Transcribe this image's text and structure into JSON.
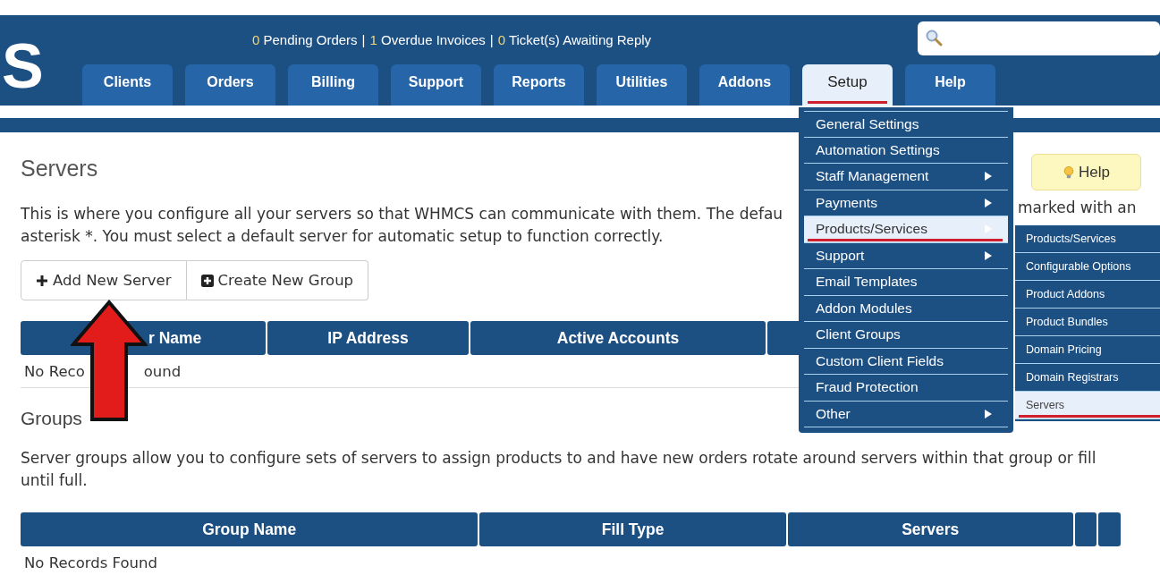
{
  "header": {
    "logo": "S",
    "separator": "|",
    "stats": [
      {
        "count": "0",
        "label": "Pending Orders"
      },
      {
        "count": "1",
        "label": "Overdue Invoices"
      },
      {
        "count": "0",
        "label": "Ticket(s) Awaiting Reply"
      }
    ]
  },
  "tabs": [
    {
      "label": "Clients",
      "selected": false
    },
    {
      "label": "Orders",
      "selected": false
    },
    {
      "label": "Billing",
      "selected": false
    },
    {
      "label": "Support",
      "selected": false
    },
    {
      "label": "Reports",
      "selected": false
    },
    {
      "label": "Utilities",
      "selected": false
    },
    {
      "label": "Addons",
      "selected": false
    },
    {
      "label": "Setup",
      "selected": true
    },
    {
      "label": "Help",
      "selected": false
    }
  ],
  "setup_menu": [
    {
      "label": "General Settings",
      "has_submenu": false,
      "selected": false
    },
    {
      "label": "Automation Settings",
      "has_submenu": false,
      "selected": false
    },
    {
      "label": "Staff Management",
      "has_submenu": true,
      "selected": false
    },
    {
      "label": "Payments",
      "has_submenu": true,
      "selected": false
    },
    {
      "label": "Products/Services",
      "has_submenu": true,
      "selected": true
    },
    {
      "label": "Support",
      "has_submenu": true,
      "selected": false
    },
    {
      "label": "Email Templates",
      "has_submenu": false,
      "selected": false
    },
    {
      "label": "Addon Modules",
      "has_submenu": false,
      "selected": false
    },
    {
      "label": "Client Groups",
      "has_submenu": false,
      "selected": false
    },
    {
      "label": "Custom Client Fields",
      "has_submenu": false,
      "selected": false
    },
    {
      "label": "Fraud Protection",
      "has_submenu": false,
      "selected": false
    },
    {
      "label": "Other",
      "has_submenu": true,
      "selected": false
    }
  ],
  "submenu": [
    {
      "label": "Products/Services",
      "selected": false
    },
    {
      "label": "Configurable Options",
      "selected": false
    },
    {
      "label": "Product Addons",
      "selected": false
    },
    {
      "label": "Product Bundles",
      "selected": false
    },
    {
      "label": "Domain Pricing",
      "selected": false
    },
    {
      "label": "Domain Registrars",
      "selected": false
    },
    {
      "label": "Servers",
      "selected": true
    }
  ],
  "page": {
    "title": "Servers",
    "help_button": "Help",
    "intro": [
      "This is where you configure all your servers so that WHMCS can communicate with them. The defau",
      "marked with an",
      "asterisk *. You must select a default server for automatic setup to function correctly."
    ],
    "buttons": [
      {
        "label": "Add New Server",
        "kind": "plus"
      },
      {
        "label": "Create New Group",
        "kind": "plus-square"
      }
    ]
  },
  "servers_table": {
    "columns": [
      "r Name",
      "IP Address",
      "Active Accounts"
    ],
    "empty_message": [
      "No Reco",
      "ound"
    ]
  },
  "groups": {
    "title": "Groups",
    "description": "Server groups allow you to configure sets of servers to assign products to and have new orders rotate around servers within that group or fill until full.",
    "columns": [
      "Group Name",
      "Fill Type",
      "Servers"
    ],
    "empty_message": "No Records Found"
  }
}
